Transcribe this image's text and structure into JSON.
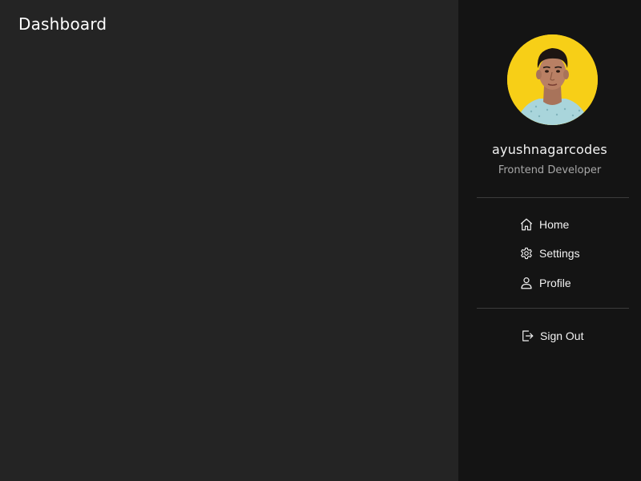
{
  "header": {
    "title": "Dashboard"
  },
  "profile": {
    "username": "ayushnagarcodes",
    "role": "Frontend Developer",
    "avatar_bg": "#f7cf17"
  },
  "nav": {
    "items": [
      {
        "label": "Home",
        "icon": "home-icon"
      },
      {
        "label": "Settings",
        "icon": "gear-icon"
      },
      {
        "label": "Profile",
        "icon": "user-icon"
      }
    ],
    "signout": {
      "label": "Sign Out",
      "icon": "sign-out-icon"
    }
  },
  "colors": {
    "main_bg": "#242424",
    "sidebar_bg": "#141414",
    "text": "#f2f2f2",
    "muted_text": "#a8a8a8"
  }
}
